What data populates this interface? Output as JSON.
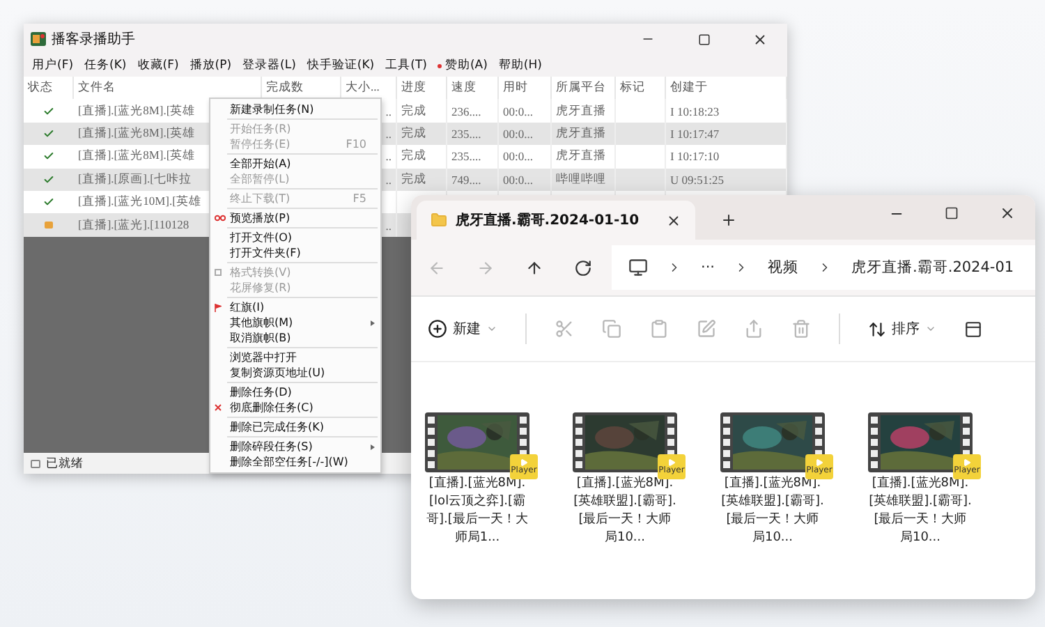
{
  "app_window": {
    "title": "播客录播助手",
    "menu": [
      {
        "label": "用户(F)",
        "dot": false
      },
      {
        "label": "任务(K)",
        "dot": false
      },
      {
        "label": "收藏(F)",
        "dot": false
      },
      {
        "label": "播放(P)",
        "dot": false
      },
      {
        "label": "登录器(L)",
        "dot": false
      },
      {
        "label": "快手验证(K)",
        "dot": false
      },
      {
        "label": "工具(T)",
        "dot": false
      },
      {
        "label": "赞助(A)",
        "dot": true
      },
      {
        "label": "帮助(H)",
        "dot": false
      }
    ],
    "table": {
      "columns": [
        "状态",
        "文件名",
        "完成数",
        "大小...",
        "进度",
        "速度",
        "用时",
        "所属平台",
        "标记",
        "创建于"
      ],
      "rows": [
        {
          "kind": "done",
          "cells": [
            "",
            "[直播].[蓝光8M].[英雄",
            "",
            "..",
            "完成",
            "236....",
            "00:0...",
            "虎牙直播",
            "",
            "I 10:18:23"
          ]
        },
        {
          "kind": "done",
          "cells": [
            "",
            "[直播].[蓝光8M].[英雄",
            "",
            "..",
            "完成",
            "235....",
            "00:0...",
            "虎牙直播",
            "",
            "I 10:17:47"
          ]
        },
        {
          "kind": "done",
          "cells": [
            "",
            "[直播].[蓝光8M].[英雄",
            "",
            "..",
            "完成",
            "235....",
            "00:0...",
            "虎牙直播",
            "",
            "I 10:17:10"
          ]
        },
        {
          "kind": "done",
          "cells": [
            "",
            "[直播].[原画].[七咔拉",
            "",
            "..",
            "完成",
            "749....",
            "00:0...",
            "哔哩哔哩",
            "",
            "U 09:51:25"
          ]
        },
        {
          "kind": "done",
          "cells": [
            "",
            "[直播].[蓝光10M].[英雄",
            "",
            "",
            "",
            "",
            "",
            "",
            "",
            ""
          ]
        },
        {
          "kind": "waiting",
          "cells": [
            "",
            "[直播].[蓝光].[110128",
            "",
            "..",
            "",
            "",
            "",
            "",
            "",
            ""
          ]
        }
      ]
    },
    "status_bar": "已就绪"
  },
  "context_menu": [
    {
      "kind": "item",
      "label": "新建录制任务(N)",
      "disabled": false
    },
    {
      "kind": "separator"
    },
    {
      "kind": "item",
      "label": "开始任务(R)",
      "disabled": true
    },
    {
      "kind": "item",
      "label": "暂停任务(E)",
      "shortcut": "F10",
      "disabled": true
    },
    {
      "kind": "separator"
    },
    {
      "kind": "item",
      "label": "全部开始(A)",
      "disabled": false
    },
    {
      "kind": "item",
      "label": "全部暂停(L)",
      "disabled": true
    },
    {
      "kind": "separator"
    },
    {
      "kind": "item",
      "label": "终止下载(T)",
      "shortcut": "F5",
      "disabled": true
    },
    {
      "kind": "separator"
    },
    {
      "kind": "preview",
      "label": "预览播放(P)",
      "disabled": false
    },
    {
      "kind": "separator"
    },
    {
      "kind": "item",
      "label": "打开文件(O)",
      "disabled": false
    },
    {
      "kind": "item",
      "label": "打开文件夹(F)",
      "disabled": false
    },
    {
      "kind": "separator"
    },
    {
      "kind": "convert",
      "label": "格式转换(V)",
      "disabled": true
    },
    {
      "kind": "item",
      "label": "花屏修复(R)",
      "disabled": true
    },
    {
      "kind": "separator"
    },
    {
      "kind": "flag",
      "label": "红旗(I)",
      "disabled": false
    },
    {
      "kind": "item",
      "label": "其他旗帜(M)",
      "disabled": false,
      "submenu": true
    },
    {
      "kind": "item",
      "label": "取消旗帜(B)",
      "disabled": false
    },
    {
      "kind": "separator"
    },
    {
      "kind": "item",
      "label": "浏览器中打开",
      "disabled": false
    },
    {
      "kind": "item",
      "label": "复制资源页地址(U)",
      "disabled": false
    },
    {
      "kind": "separator"
    },
    {
      "kind": "item",
      "label": "删除任务(D)",
      "disabled": false
    },
    {
      "kind": "purge",
      "label": "彻底删除任务(C)",
      "disabled": false
    },
    {
      "kind": "separator"
    },
    {
      "kind": "item",
      "label": "删除已完成任务(K)",
      "disabled": false
    },
    {
      "kind": "separator"
    },
    {
      "kind": "item",
      "label": "删除碎段任务(S)",
      "disabled": false,
      "submenu": true
    },
    {
      "kind": "item",
      "label": "删除全部空任务[-/-](W)",
      "disabled": false
    }
  ],
  "explorer_window": {
    "tab": "虎牙直播.霸哥.2024-01-10",
    "nav": [
      {
        "disabled": true
      },
      {
        "disabled": true
      },
      {
        "disabled": false
      },
      {
        "disabled": false
      }
    ],
    "breadcrumb": [
      "···",
      "视频",
      "虎牙直播.霸哥.2024-01"
    ],
    "toolbar": {
      "new": "新建",
      "actions": [
        {
          "disabled": true
        },
        {
          "disabled": true
        },
        {
          "disabled": true
        },
        {
          "disabled": true
        },
        {
          "disabled": true
        },
        {
          "disabled": true
        }
      ],
      "sort": "排序"
    },
    "files": [
      {
        "name": "[直播].[蓝光8M].[lol云顶之弈].[霸哥].[最后一天！大师局1...",
        "badge": "Player"
      },
      {
        "name": "[直播].[蓝光8M].[英雄联盟].[霸哥].[最后一天！大师局10...",
        "badge": "Player"
      },
      {
        "name": "[直播].[蓝光8M].[英雄联盟].[霸哥].[最后一天！大师局10...",
        "badge": "Player"
      },
      {
        "name": "[直播].[蓝光8M].[英雄联盟].[霸哥].[最后一天！大师局10...",
        "badge": "Player"
      }
    ]
  }
}
